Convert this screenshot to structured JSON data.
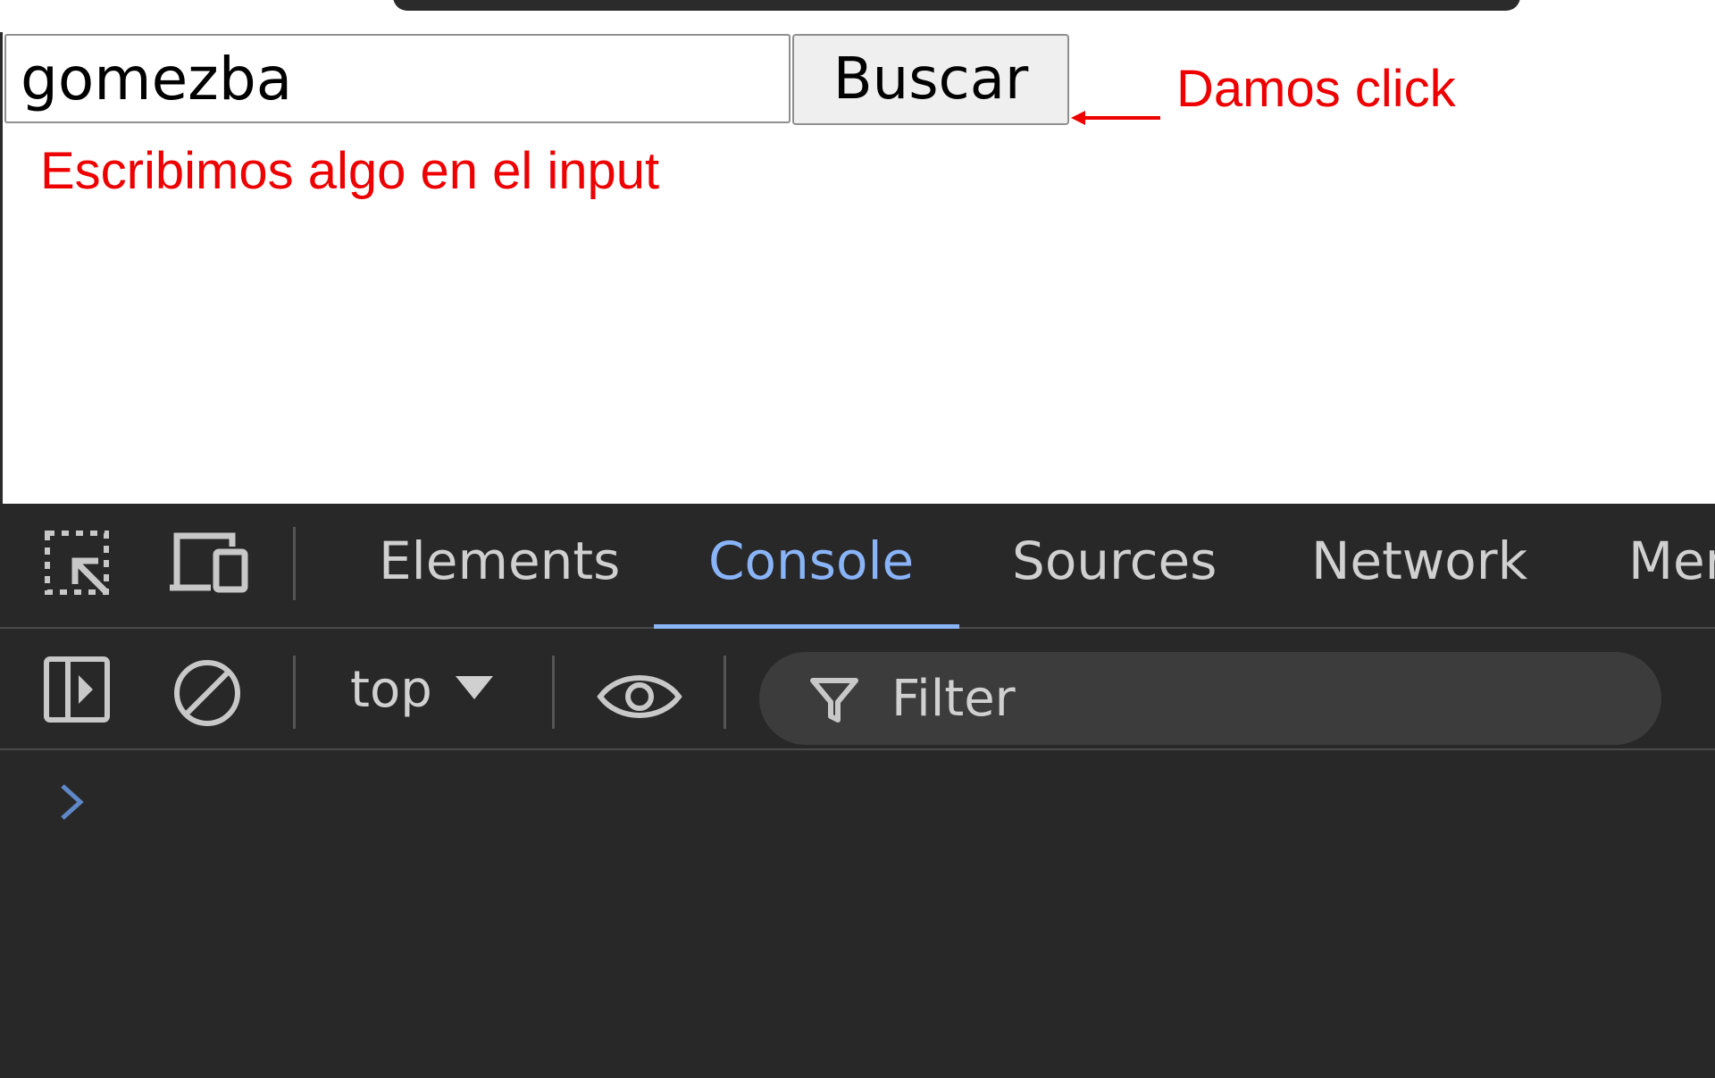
{
  "page": {
    "search_input": {
      "value": "gomezba",
      "placeholder": ""
    },
    "search_button_label": "Buscar"
  },
  "annotations": {
    "click_note": "Damos click",
    "input_note": "Escribimos algo en el input",
    "color": "#ee0000"
  },
  "devtools": {
    "tabs": [
      {
        "label": "Elements",
        "active": false
      },
      {
        "label": "Console",
        "active": true
      },
      {
        "label": "Sources",
        "active": false
      },
      {
        "label": "Network",
        "active": false
      },
      {
        "label": "Mer",
        "active": false
      }
    ],
    "toolbar": {
      "context_label": "top",
      "filter_placeholder": "Filter"
    },
    "icons": {
      "inspect": "inspect-element-icon",
      "device": "device-toolbar-icon",
      "sidebar": "show-sidebar-icon",
      "clear": "clear-console-icon",
      "eye": "live-expression-icon",
      "filter": "filter-icon",
      "prompt": "console-prompt-icon"
    },
    "accent_color": "#8ab4f8",
    "background_color": "#282828"
  }
}
